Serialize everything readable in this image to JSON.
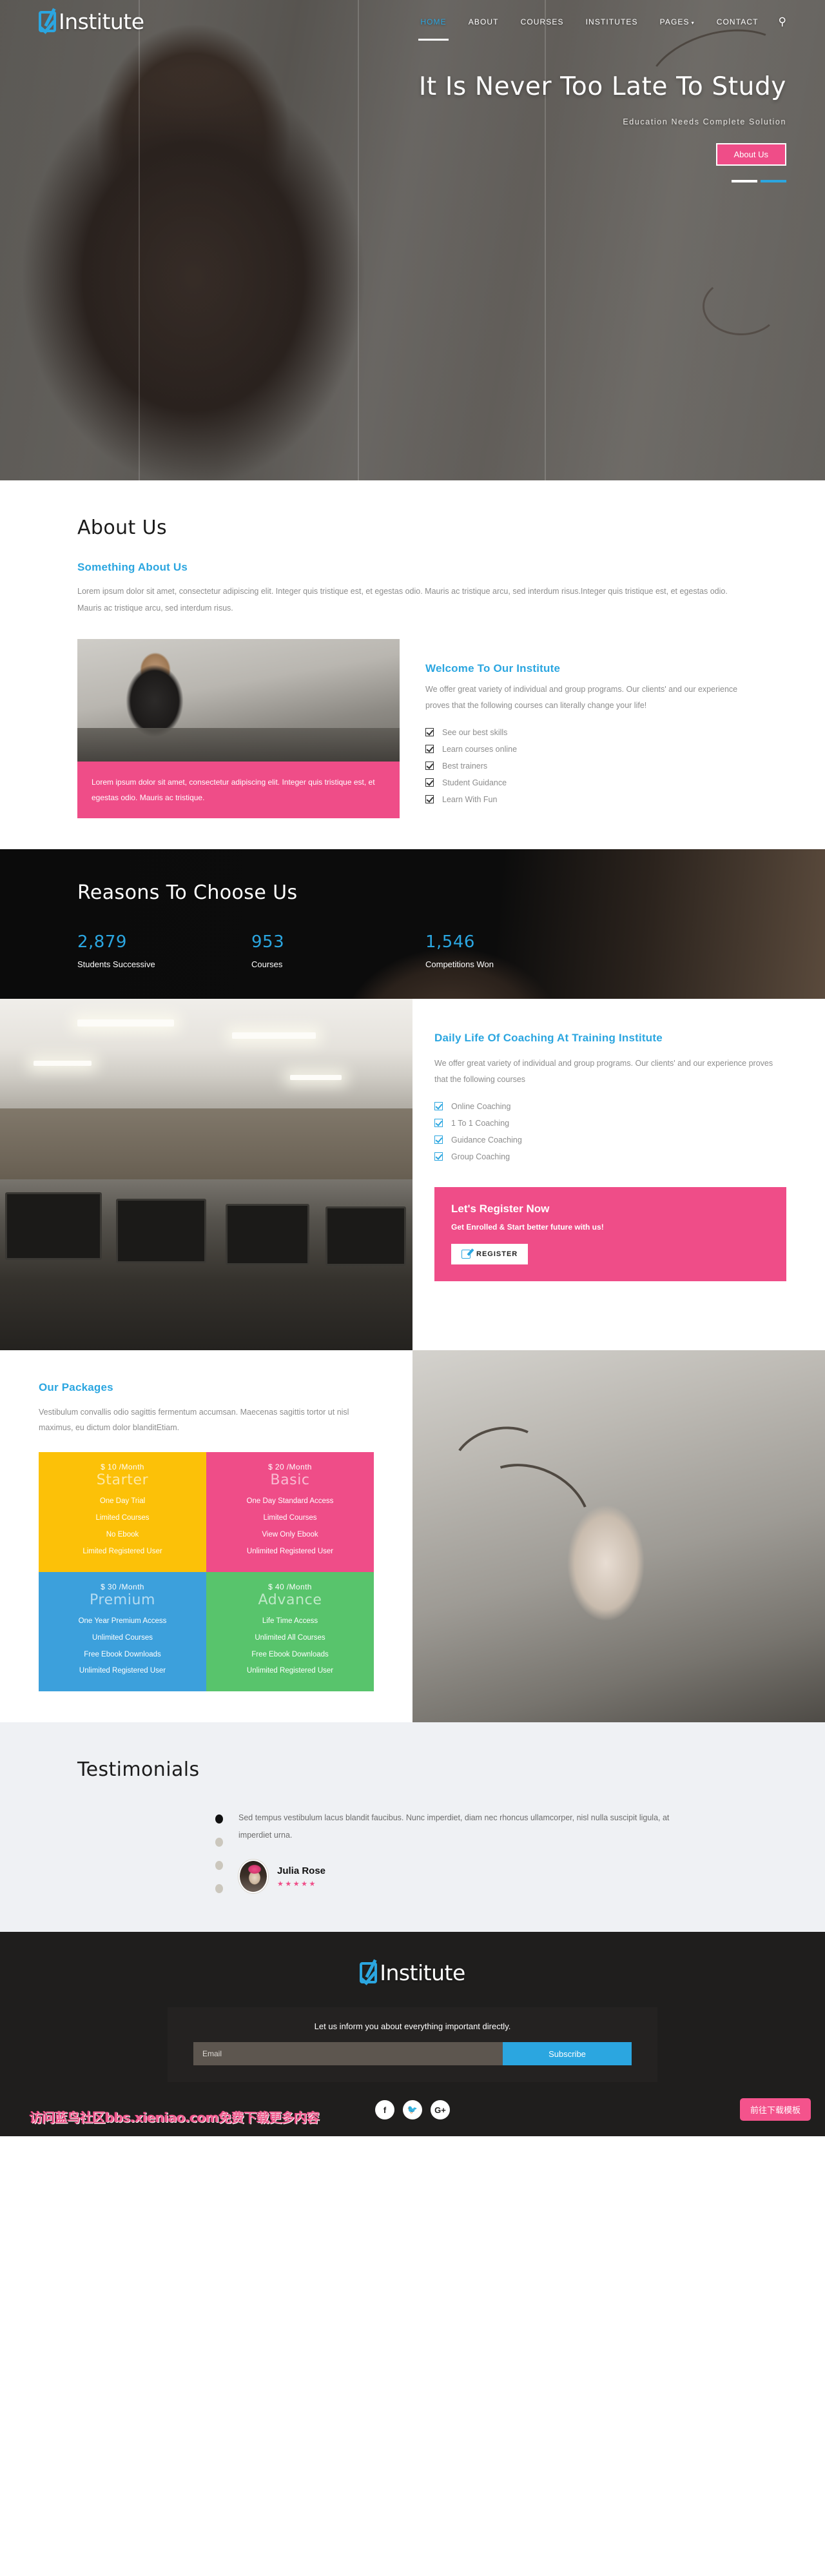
{
  "brand": {
    "name": "Institute",
    "logo_icon": "checkbox-check-icon"
  },
  "nav": {
    "items": [
      {
        "label": "HOME",
        "active": true
      },
      {
        "label": "ABOUT",
        "active": false
      },
      {
        "label": "COURSES",
        "active": false
      },
      {
        "label": "INSTITUTES",
        "active": false
      },
      {
        "label": "PAGES",
        "active": false,
        "caret": "▾"
      },
      {
        "label": "CONTACT",
        "active": false
      }
    ],
    "search_icon": "search-icon"
  },
  "hero": {
    "title": "It Is Never Too Late To Study",
    "subtitle": "Education Needs Complete Solution",
    "cta": "About Us",
    "slides": 2,
    "active_slide": 2
  },
  "about": {
    "title": "About Us",
    "subheading": "Something About Us",
    "paragraph": "Lorem ipsum dolor sit amet, consectetur adipiscing elit. Integer quis tristique est, et egestas odio. Mauris ac tristique arcu, sed interdum risus.Integer quis tristique est, et egestas odio. Mauris ac tristique arcu, sed interdum risus.",
    "quote": "Lorem ipsum dolor sit amet, consectetur adipiscing elit. Integer quis tristique est, et egestas odio. Mauris ac tristique.",
    "welcome_heading": "Welcome To Our Institute",
    "welcome_text": "We offer great variety of individual and group programs. Our clients' and our experience proves that the following courses can literally change your life!",
    "checklist": [
      "See our best skills",
      "Learn courses online",
      "Best trainers",
      "Student Guidance",
      "Learn With Fun"
    ]
  },
  "reasons": {
    "title": "Reasons To Choose Us",
    "stats": [
      {
        "number": "2,879",
        "label": "Students Successive"
      },
      {
        "number": "953",
        "label": "Courses"
      },
      {
        "number": "1,546",
        "label": "Competitions Won"
      }
    ]
  },
  "daily": {
    "heading": "Daily Life Of Coaching At Training Institute",
    "paragraph": "We offer great variety of individual and group programs. Our clients' and our experience proves that the following courses",
    "checklist": [
      "Online Coaching",
      "1 To 1 Coaching",
      "Guidance Coaching",
      "Group Coaching"
    ],
    "register": {
      "heading": "Let's Register Now",
      "subheading": "Get Enrolled & Start better future with us!",
      "button": "REGISTER",
      "button_icon": "pen-edit-icon"
    }
  },
  "packages": {
    "heading": "Our Packages",
    "paragraph": "Vestibulum convallis odio sagittis fermentum accumsan. Maecenas sagittis tortor ut nisl maximus, eu dictum dolor blanditEtiam.",
    "cards": [
      {
        "price": "$ 10 /Month",
        "plan": "Starter",
        "color": "#fcc108",
        "features": [
          "One Day Trial",
          "Limited Courses",
          "No Ebook",
          "Limited Registered User"
        ]
      },
      {
        "price": "$ 20 /Month",
        "plan": "Basic",
        "color": "#ef4d88",
        "features": [
          "One Day Standard Access",
          "Limited Courses",
          "View Only Ebook",
          "Unlimited Registered User"
        ]
      },
      {
        "price": "$ 30 /Month",
        "plan": "Premium",
        "color": "#3ca0dc",
        "features": [
          "One Year Premium Access",
          "Unlimited Courses",
          "Free Ebook Downloads",
          "Unlimited Registered User"
        ]
      },
      {
        "price": "$ 40 /Month",
        "plan": "Advance",
        "color": "#58c46c",
        "features": [
          "Life Time Access",
          "Unlimited All Courses",
          "Free Ebook Downloads",
          "Unlimited Registered User"
        ]
      }
    ]
  },
  "testimonials": {
    "title": "Testimonials",
    "quote": "Sed tempus vestibulum lacus blandit faucibus. Nunc imperdiet, diam nec rhoncus ullamcorper, nisl nulla suscipit ligula, at imperdiet urna.",
    "author": "Julia Rose",
    "stars": "★★★★★",
    "dot_count": 4,
    "active_dot": 1
  },
  "footer": {
    "brand": "Institute",
    "newsletter_text": "Let us inform you about everything important directly.",
    "email_placeholder": "Email",
    "email_value": "",
    "subscribe": "Subscribe",
    "social": [
      {
        "icon": "facebook-icon",
        "glyph": "f"
      },
      {
        "icon": "twitter-icon",
        "glyph": "🐦"
      },
      {
        "icon": "google-plus-icon",
        "glyph": "G+"
      }
    ]
  },
  "overlay": {
    "watermark": "访问蓝鸟社区bbs.xieniao.com免费下载更多内容",
    "download_button": "前往下载模板"
  }
}
